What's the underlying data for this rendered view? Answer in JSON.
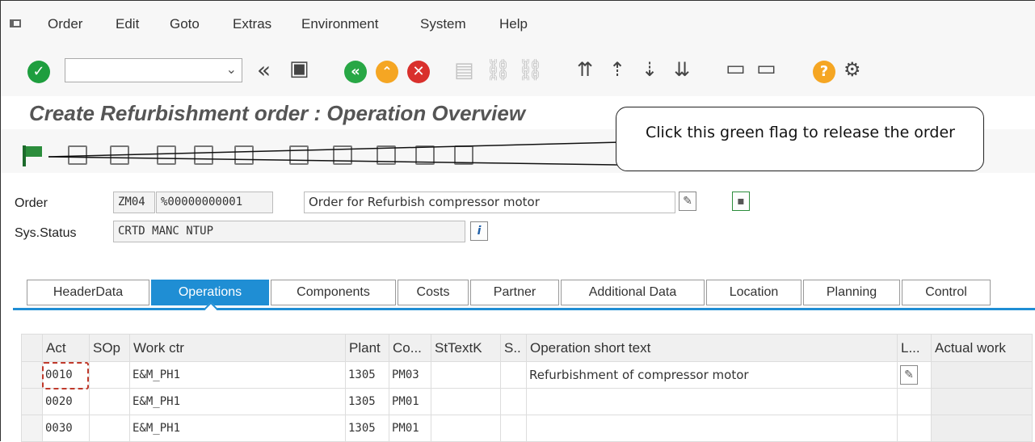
{
  "menu": {
    "items": [
      "Order",
      "Edit",
      "Goto",
      "Extras",
      "Environment",
      "System",
      "Help"
    ]
  },
  "toolbar": {
    "icons": [
      "enter-icon",
      "command-field",
      "back-double-icon",
      "save-icon",
      "back-icon",
      "exit-icon",
      "cancel-icon",
      "print-icon",
      "find-icon",
      "find-next-icon",
      "first-page-icon",
      "previous-page-icon",
      "next-page-icon",
      "last-page-icon",
      "create-session-icon",
      "shortcut-icon",
      "help-icon",
      "settings-icon"
    ]
  },
  "page": {
    "title": "Create Refurbishment order : Operation Overview"
  },
  "callout": {
    "text": "Click this green flag to release the order"
  },
  "header": {
    "order_label": "Order",
    "order_type": "ZM04",
    "order_number": "%00000000001",
    "order_description": "Order for Refurbish compressor motor",
    "status_label": "Sys.Status",
    "status_value": "CRTD MANC NTUP"
  },
  "tabs": [
    {
      "label": "HeaderData"
    },
    {
      "label": "Operations"
    },
    {
      "label": "Components"
    },
    {
      "label": "Costs"
    },
    {
      "label": "Partner"
    },
    {
      "label": "Additional Data"
    },
    {
      "label": "Location"
    },
    {
      "label": "Planning"
    },
    {
      "label": "Control"
    }
  ],
  "table": {
    "columns": [
      "Act",
      "SOp",
      "Work ctr",
      "Plant",
      "Co...",
      "StTextK",
      "S..",
      "Operation short text",
      "L...",
      "Actual work"
    ],
    "rows": [
      {
        "act": "0010",
        "sop": "",
        "work_ctr": "E&M_PH1",
        "plant": "1305",
        "co": "PM03",
        "sttextk": "",
        "s": "",
        "text": "Refurbishment of compressor motor"
      },
      {
        "act": "0020",
        "sop": "",
        "work_ctr": "E&M_PH1",
        "plant": "1305",
        "co": "PM01",
        "sttextk": "",
        "s": "",
        "text": ""
      },
      {
        "act": "0030",
        "sop": "",
        "work_ctr": "E&M_PH1",
        "plant": "1305",
        "co": "PM01",
        "sttextk": "",
        "s": "",
        "text": ""
      }
    ]
  },
  "colors": {
    "accent": "#1f8ed4",
    "flag": "#2c8d3c",
    "ok_green": "#1e9e3e",
    "nav_green": "#28a745",
    "nav_orange": "#f5a623",
    "cancel_red": "#d9302c",
    "help_orange": "#f5a623"
  }
}
